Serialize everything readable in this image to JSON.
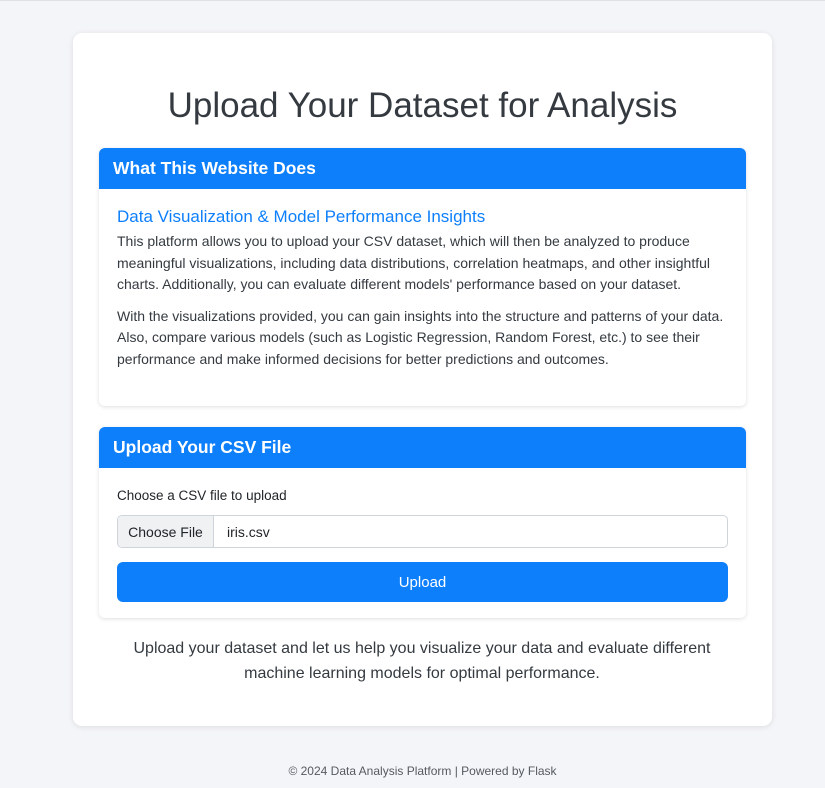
{
  "page": {
    "title": "Upload Your Dataset for Analysis"
  },
  "info_card": {
    "header": "What This Website Does",
    "subtitle": "Data Visualization & Model Performance Insights",
    "paragraph_1": "This platform allows you to upload your CSV dataset, which will then be analyzed to produce meaningful visualizations, including data distributions, correlation heatmaps, and other insightful charts. Additionally, you can evaluate different models' performance based on your dataset.",
    "paragraph_2": "With the visualizations provided, you can gain insights into the structure and patterns of your data. Also, compare various models (such as Logistic Regression, Random Forest, etc.) to see their performance and make informed decisions for better predictions and outcomes."
  },
  "upload_card": {
    "header": "Upload Your CSV File",
    "label": "Choose a CSV file to upload",
    "choose_file_label": "Choose File",
    "selected_file": "iris.csv",
    "upload_button_label": "Upload"
  },
  "cta_text": "Upload your dataset and let us help you visualize your data and evaluate different machine learning models for optimal performance.",
  "footer_text": "© 2024 Data Analysis Platform | Powered by Flask",
  "colors": {
    "primary": "#0d7ffb",
    "background": "#f4f5f8"
  }
}
